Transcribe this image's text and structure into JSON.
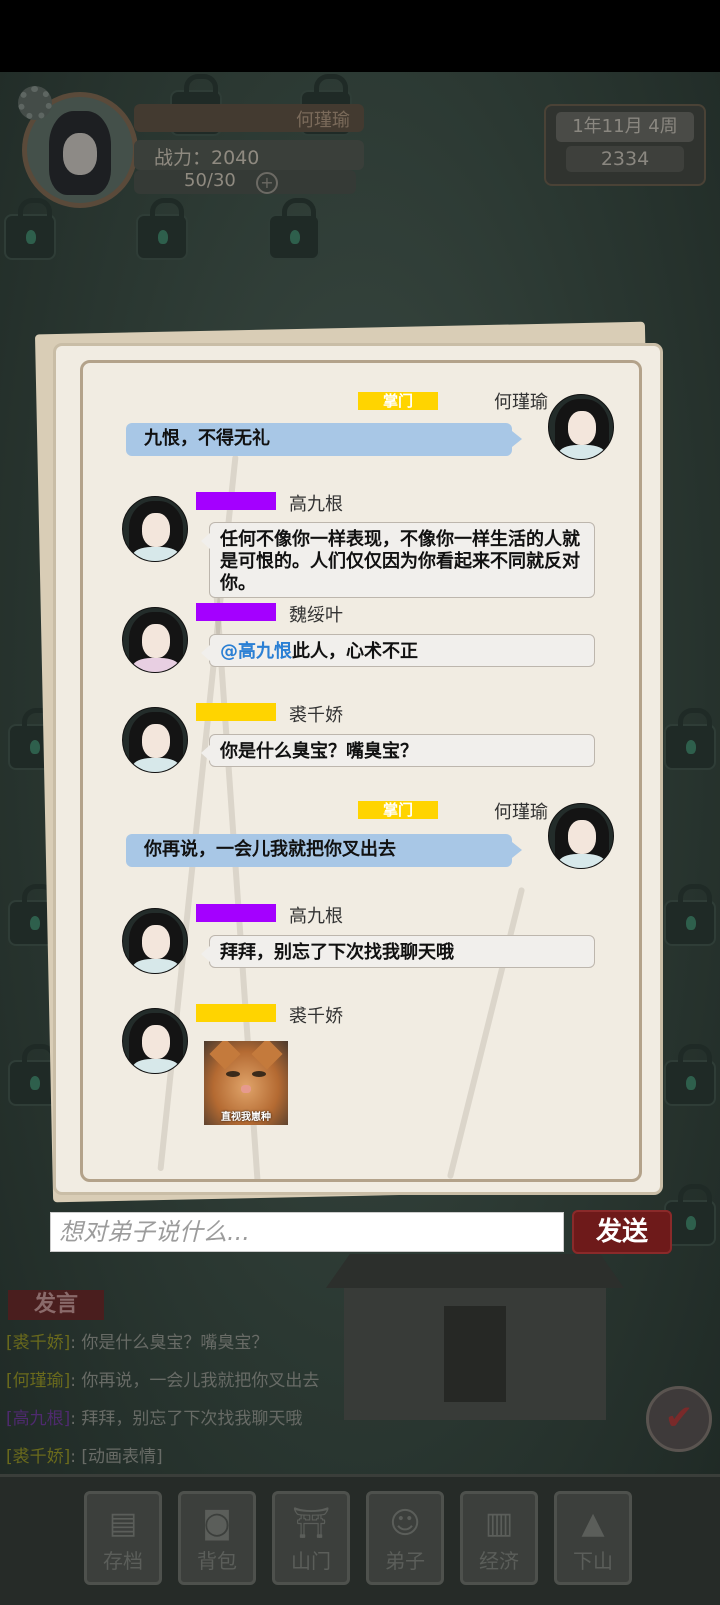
{
  "header": {
    "player_name": "何瑾瑜",
    "power_text": "战力：2040",
    "stamina_text": "50/30",
    "plus_label": "+",
    "date_text": "1年11月  4周",
    "coins_text": "2334"
  },
  "chat": {
    "messages": [
      {
        "role": "掌门",
        "sender": "何瑾瑜",
        "text": "九恨，不得无礼"
      },
      {
        "sender": "高九根",
        "text": "任何不像你一样表现，不像你一样生活的人就是可恨的。人们仅仅因为你看起来不同就反对你。"
      },
      {
        "sender": "魏绥叶",
        "mention": "@高九恨",
        "text": "此人，心术不正"
      },
      {
        "sender": "裘千娇",
        "text": "你是什么臭宝？嘴臭宝？"
      },
      {
        "role": "掌门",
        "sender": "何瑾瑜",
        "text": "你再说，一会儿我就把你叉出去"
      },
      {
        "sender": "高九根",
        "text": "拜拜，别忘了下次找我聊天哦"
      },
      {
        "sender": "裘千娇",
        "sticker_caption": "直视我崽种"
      }
    ],
    "input_placeholder": "想对弟子说什么...",
    "send_label": "发送"
  },
  "log": {
    "title": "发言",
    "lines": [
      {
        "name": "[裘千娇]",
        "sep": ": ",
        "text": "你是什么臭宝？嘴臭宝？"
      },
      {
        "name": "[何瑾瑜]",
        "sep": ": ",
        "text": "你再说，一会儿我就把你叉出去"
      },
      {
        "name": "[高九根]",
        "sep": ": ",
        "text": "拜拜，别忘了下次找我聊天哦"
      },
      {
        "name": "[裘千娇]",
        "sep": ": ",
        "text": "[动画表情]"
      }
    ]
  },
  "nav": {
    "items": [
      {
        "label": "存档",
        "icon": "book-icon"
      },
      {
        "label": "背包",
        "icon": "bag-icon"
      },
      {
        "label": "山门",
        "icon": "gate-icon"
      },
      {
        "label": "弟子",
        "icon": "disciple-icon"
      },
      {
        "label": "经济",
        "icon": "economy-icon"
      },
      {
        "label": "下山",
        "icon": "mountain-icon"
      }
    ]
  },
  "colors": {
    "tag_purple": "#a400ff",
    "tag_yellow": "#ffd400",
    "self_bubble": "#a8c7e6",
    "mention": "#2a7fd4",
    "send_button": "#6e1a1a"
  }
}
